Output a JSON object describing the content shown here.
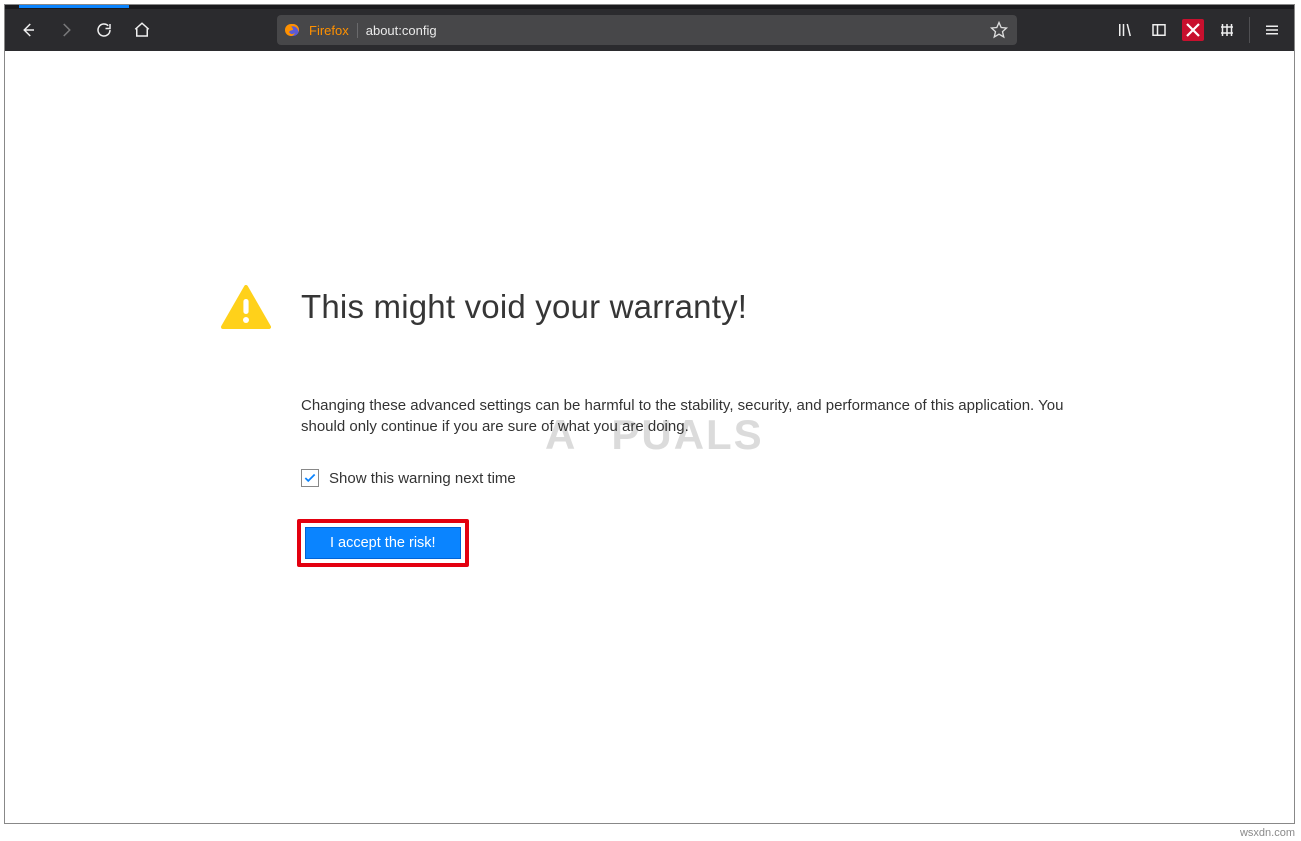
{
  "toolbar": {
    "identity_label": "Firefox",
    "url_text": "about:config"
  },
  "warning": {
    "title": "This might void your warranty!",
    "body": "Changing these advanced settings can be harmful to the stability, security, and performance of this application. You should only continue if you are sure of what you are doing.",
    "checkbox_label": "Show this warning next time",
    "checkbox_checked": true,
    "accept_button_label": "I accept the risk!"
  },
  "watermark": {
    "part1": "A",
    "part2": "PUALS"
  },
  "source_tag": "wsxdn.com"
}
